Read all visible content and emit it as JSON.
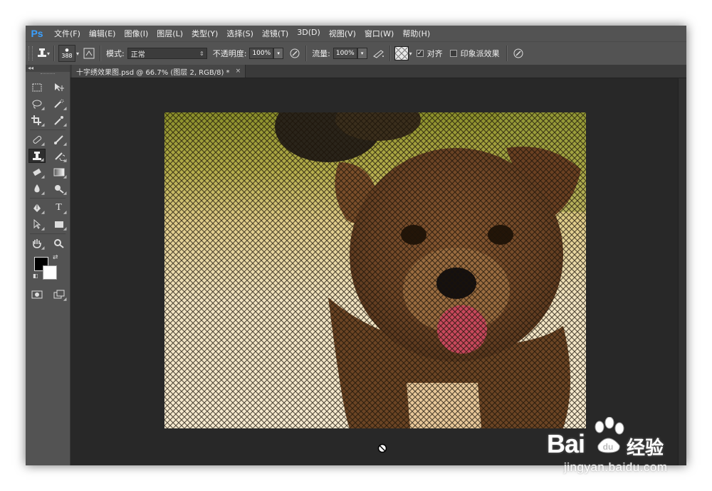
{
  "app": {
    "logo": "Ps"
  },
  "menu": [
    {
      "label": "文件(F)"
    },
    {
      "label": "编辑(E)"
    },
    {
      "label": "图像(I)"
    },
    {
      "label": "图层(L)"
    },
    {
      "label": "类型(Y)"
    },
    {
      "label": "选择(S)"
    },
    {
      "label": "滤镜(T)"
    },
    {
      "label": "3D(D)"
    },
    {
      "label": "视图(V)"
    },
    {
      "label": "窗口(W)"
    },
    {
      "label": "帮助(H)"
    }
  ],
  "options": {
    "brush_size": "388",
    "mode_label": "模式:",
    "mode_value": "正常",
    "opacity_label": "不透明度:",
    "opacity_value": "100%",
    "flow_label": "流量:",
    "flow_value": "100%",
    "aligned_label": "对齐",
    "aligned_checked": true,
    "impressionist_label": "印象派效果",
    "impressionist_checked": false
  },
  "toolbox": {
    "collapse_glyph": "◂◂",
    "tools": [
      [
        "rectangular-marquee-icon",
        "move-icon"
      ],
      [
        "lasso-icon",
        "quick-selection-icon"
      ],
      [
        "crop-icon",
        "eyedropper-icon"
      ],
      [
        "spot-healing-icon",
        "brush-icon"
      ],
      [
        "pattern-stamp-icon",
        "history-brush-icon"
      ],
      [
        "eraser-icon",
        "gradient-icon"
      ],
      [
        "blur-icon",
        "dodge-icon"
      ],
      [
        "pen-icon",
        "type-icon"
      ],
      [
        "path-selection-icon",
        "rectangle-shape-icon"
      ],
      [
        "hand-icon",
        "zoom-icon"
      ]
    ],
    "active_tool": "pattern-stamp-icon",
    "foreground_color": "#000000",
    "background_color": "#ffffff"
  },
  "document": {
    "tab_title": "十字绣效果图.psd @ 66.7% (图层 2, RGB/8) *",
    "close_glyph": "×"
  },
  "watermark": {
    "brand": "Bai",
    "brand_cn": "经验",
    "url": "jingyan.baidu.com"
  },
  "colors": {
    "ui_dark": "#282828",
    "ui_panel": "#535353",
    "ps_blue": "#3aa0ff"
  }
}
